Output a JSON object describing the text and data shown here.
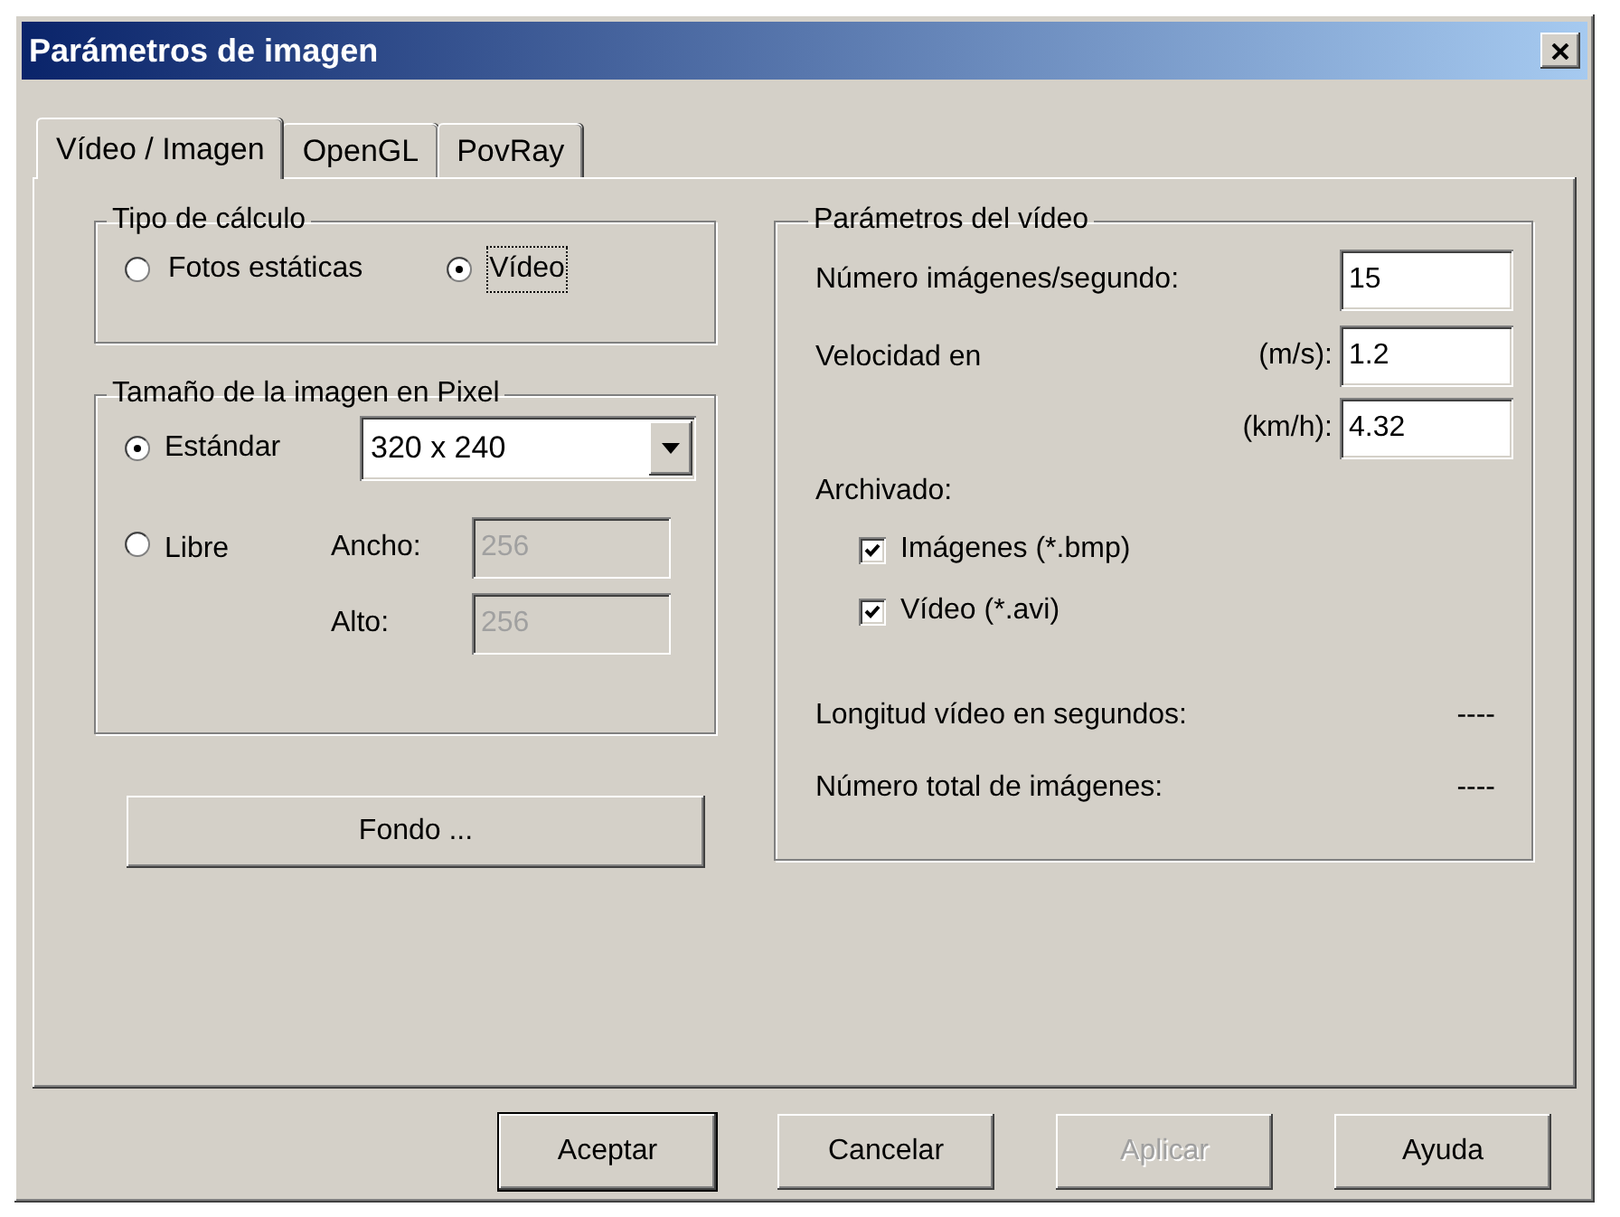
{
  "window": {
    "title": "Parámetros de imagen"
  },
  "tabs": [
    {
      "label": "Vídeo / Imagen",
      "selected": true
    },
    {
      "label": "OpenGL",
      "selected": false
    },
    {
      "label": "PovRay",
      "selected": false
    }
  ],
  "calc_type": {
    "title": "Tipo de cálculo",
    "options": [
      {
        "label": "Fotos estáticas",
        "selected": false,
        "focused": false
      },
      {
        "label": "Vídeo",
        "selected": true,
        "focused": true
      }
    ]
  },
  "image_size": {
    "title": "Tamaño de la imagen en Pixel",
    "options": [
      {
        "label": "Estándar",
        "selected": true
      },
      {
        "label": "Libre",
        "selected": false
      }
    ],
    "size_select": {
      "value": "320 x 240"
    },
    "width": {
      "label": "Ancho:",
      "value": "256",
      "disabled": true
    },
    "height": {
      "label": "Alto:",
      "value": "256",
      "disabled": true
    }
  },
  "background_button": {
    "label": "Fondo ..."
  },
  "video_params": {
    "title": "Parámetros del vídeo",
    "fps": {
      "label": "Número imágenes/segundo:",
      "value": "15"
    },
    "speed": {
      "label": "Velocidad en",
      "units": [
        {
          "label": "(m/s):",
          "value": "1.2"
        },
        {
          "label": "(km/h):",
          "value": "4.32"
        }
      ]
    },
    "archive": {
      "label": "Archivado:",
      "options": [
        {
          "label": "Imágenes (*.bmp)",
          "checked": true
        },
        {
          "label": "Vídeo (*.avi)",
          "checked": true
        }
      ]
    },
    "stats": [
      {
        "label": "Longitud vídeo en segundos:",
        "value": "----"
      },
      {
        "label": "Número total de imágenes:",
        "value": "----"
      }
    ]
  },
  "buttons": [
    {
      "label": "Aceptar",
      "default": true,
      "disabled": false
    },
    {
      "label": "Cancelar",
      "default": false,
      "disabled": false
    },
    {
      "label": "Aplicar",
      "default": false,
      "disabled": true
    },
    {
      "label": "Ayuda",
      "default": false,
      "disabled": false
    }
  ]
}
